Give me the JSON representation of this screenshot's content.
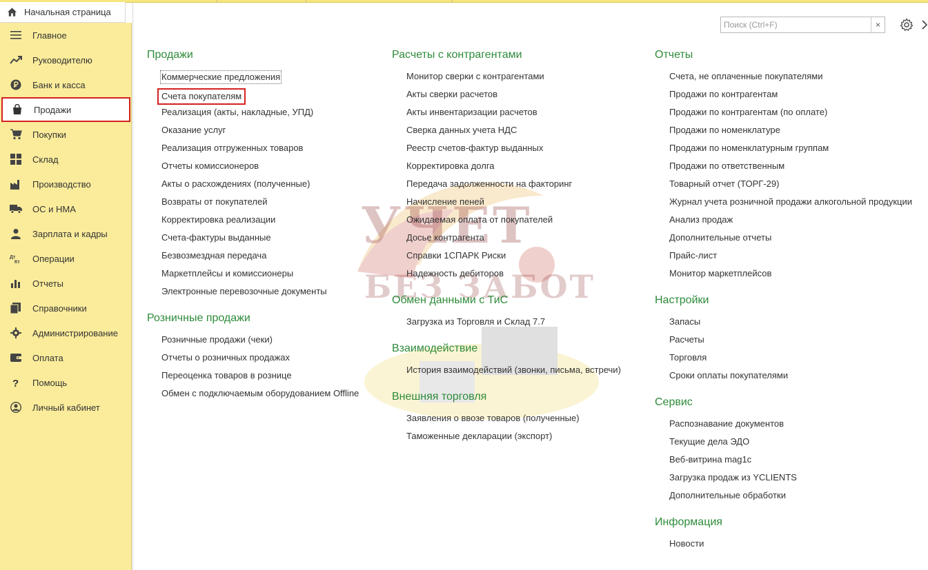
{
  "home_tab": {
    "label": "Начальная страница",
    "icon": "home-icon"
  },
  "sidebar": {
    "items": [
      {
        "label": "Главное",
        "icon": "menu-lines-icon"
      },
      {
        "label": "Руководителю",
        "icon": "trend-icon"
      },
      {
        "label": "Банк и касса",
        "icon": "ruble-coin-icon"
      },
      {
        "label": "Продажи",
        "icon": "shopping-bag-icon",
        "active": true
      },
      {
        "label": "Покупки",
        "icon": "cart-icon"
      },
      {
        "label": "Склад",
        "icon": "grid-icon"
      },
      {
        "label": "Производство",
        "icon": "factory-icon"
      },
      {
        "label": "ОС и НМА",
        "icon": "truck-icon"
      },
      {
        "label": "Зарплата и кадры",
        "icon": "person-icon"
      },
      {
        "label": "Операции",
        "icon": "dt-kt-icon"
      },
      {
        "label": "Отчеты",
        "icon": "bar-chart-icon"
      },
      {
        "label": "Справочники",
        "icon": "books-icon"
      },
      {
        "label": "Администрирование",
        "icon": "gear-icon"
      },
      {
        "label": "Оплата",
        "icon": "wallet-icon"
      },
      {
        "label": "Помощь",
        "icon": "question-icon"
      },
      {
        "label": "Личный кабинет",
        "icon": "account-icon"
      }
    ]
  },
  "search": {
    "placeholder": "Поиск (Ctrl+F)",
    "clear": "×"
  },
  "accent_color": "#2e8b3a",
  "highlight_color": "#d32020",
  "columns": [
    {
      "groups": [
        {
          "title": "Продажи",
          "links": [
            "Коммерческие предложения",
            "Счета покупателям",
            "Реализация (акты, накладные, УПД)",
            "Оказание услуг",
            "Реализация отгруженных товаров",
            "Отчеты комиссионеров",
            "Акты о расхождениях (полученные)",
            "Возвраты от покупателей",
            "Корректировка реализации",
            "Счета-фактуры выданные",
            "Безвозмездная передача",
            "Маркетплейсы и комиссионеры",
            "Электронные перевозочные документы"
          ]
        },
        {
          "title": "Розничные продажи",
          "links": [
            "Розничные продажи (чеки)",
            "Отчеты о розничных продажах",
            "Переоценка товаров в рознице",
            "Обмен с подключаемым оборудованием Offline"
          ]
        }
      ]
    },
    {
      "groups": [
        {
          "title": "Расчеты с контрагентами",
          "links": [
            "Монитор сверки с контрагентами",
            "Акты сверки расчетов",
            "Акты инвентаризации расчетов",
            "Сверка данных учета НДС",
            "Реестр счетов-фактур выданных",
            "Корректировка долга",
            "Передача задолженности на факторинг",
            "Начисление пеней",
            "Ожидаемая оплата от покупателей",
            "Досье контрагента",
            "Справки 1СПАРК Риски",
            "Надежность дебиторов"
          ]
        },
        {
          "title": "Обмен данными с ТиС",
          "links": [
            "Загрузка из Торговля и Склад 7.7"
          ]
        },
        {
          "title": "Взаимодействие",
          "links": [
            "История взаимодействий (звонки, письма, встречи)"
          ]
        },
        {
          "title": "Внешняя торговля",
          "links": [
            "Заявления о ввозе товаров (полученные)",
            "Таможенные декларации (экспорт)"
          ]
        }
      ]
    },
    {
      "groups": [
        {
          "title": "Отчеты",
          "links": [
            "Счета, не оплаченные покупателями",
            "Продажи по контрагентам",
            "Продажи по контрагентам (по оплате)",
            "Продажи по номенклатуре",
            "Продажи по номенклатурным группам",
            "Продажи по ответственным",
            "Товарный отчет (ТОРГ-29)",
            "Журнал учета розничной продажи алкогольной продукции",
            "Анализ продаж",
            "Дополнительные отчеты",
            "Прайс-лист",
            "Монитор маркетплейсов"
          ]
        },
        {
          "title": "Настройки",
          "links": [
            "Запасы",
            "Расчеты",
            "Торговля",
            "Сроки оплаты покупателями"
          ]
        },
        {
          "title": "Сервис",
          "links": [
            "Распознавание документов",
            "Текущие дела ЭДО",
            "Веб-витрина mag1c",
            "Загрузка продаж из YCLIENTS",
            "Дополнительные обработки"
          ]
        },
        {
          "title": "Информация",
          "links": [
            "Новости"
          ]
        }
      ]
    }
  ],
  "watermark": {
    "line1": "УЧЕТ",
    "line2": "БЕЗ ЗАБОТ"
  }
}
